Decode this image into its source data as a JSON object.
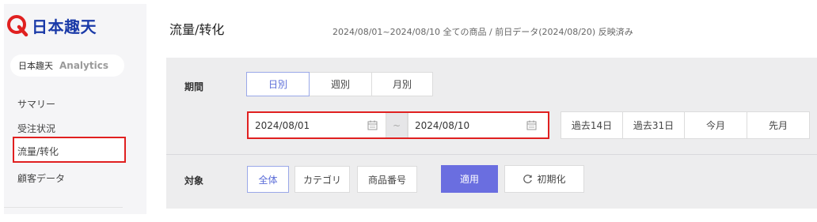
{
  "brand": {
    "logo_text": "日本趣天",
    "logo_color": "#1a3aa8",
    "logo_icon_color": "#e02020",
    "pill_name": "日本趣天",
    "pill_product": "Analytics"
  },
  "sidebar": {
    "items": [
      {
        "label": "サマリー"
      },
      {
        "label": "受注状況"
      },
      {
        "label": "流量/转化",
        "selected": true
      },
      {
        "label": "顧客データ"
      }
    ]
  },
  "header": {
    "title": "流量/转化",
    "info": "2024/08/01~2024/08/10 全ての商品 / 前日データ(2024/08/20) 反映済み"
  },
  "filters": {
    "period_label": "期間",
    "granularity": [
      "日別",
      "週別",
      "月別"
    ],
    "granularity_selected": "日別",
    "date_from": "2024/08/01",
    "date_separator": "~",
    "date_to": "2024/08/10",
    "quick_ranges": [
      "過去14日",
      "過去31日",
      "今月",
      "先月"
    ],
    "target_label": "対象",
    "targets": [
      "全体",
      "カテゴリ",
      "商品番号"
    ],
    "target_selected": "全体",
    "apply_label": "適用",
    "reset_label": "初期化"
  },
  "colors": {
    "accent": "#6a6ee0",
    "highlight_box": "#e02020",
    "active_text": "#5b6dd8"
  },
  "icons": {
    "logo": "q-logo-icon",
    "calendar": "calendar-icon",
    "reset": "refresh-icon"
  }
}
